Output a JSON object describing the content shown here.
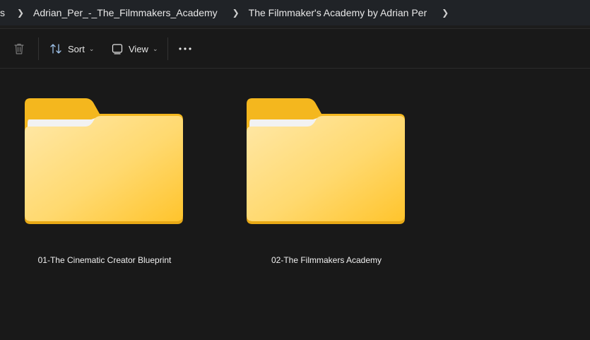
{
  "breadcrumbs": [
    {
      "label": "s"
    },
    {
      "label": "Adrian_Per_-_The_Filmmakers_Academy"
    },
    {
      "label": "The Filmmaker's Academy by Adrian Per"
    }
  ],
  "toolbar": {
    "delete_icon": "trash-icon",
    "sort_label": "Sort",
    "view_label": "View",
    "more_icon": "more-horizontal-icon"
  },
  "folders": [
    {
      "name": "01-The Cinematic Creator Blueprint"
    },
    {
      "name": "02-The Filmmakers Academy"
    }
  ],
  "colors": {
    "folder_back": "#f4b71e",
    "folder_front_light": "#ffe49c",
    "folder_front_dark": "#ffc834",
    "background": "#191919"
  }
}
